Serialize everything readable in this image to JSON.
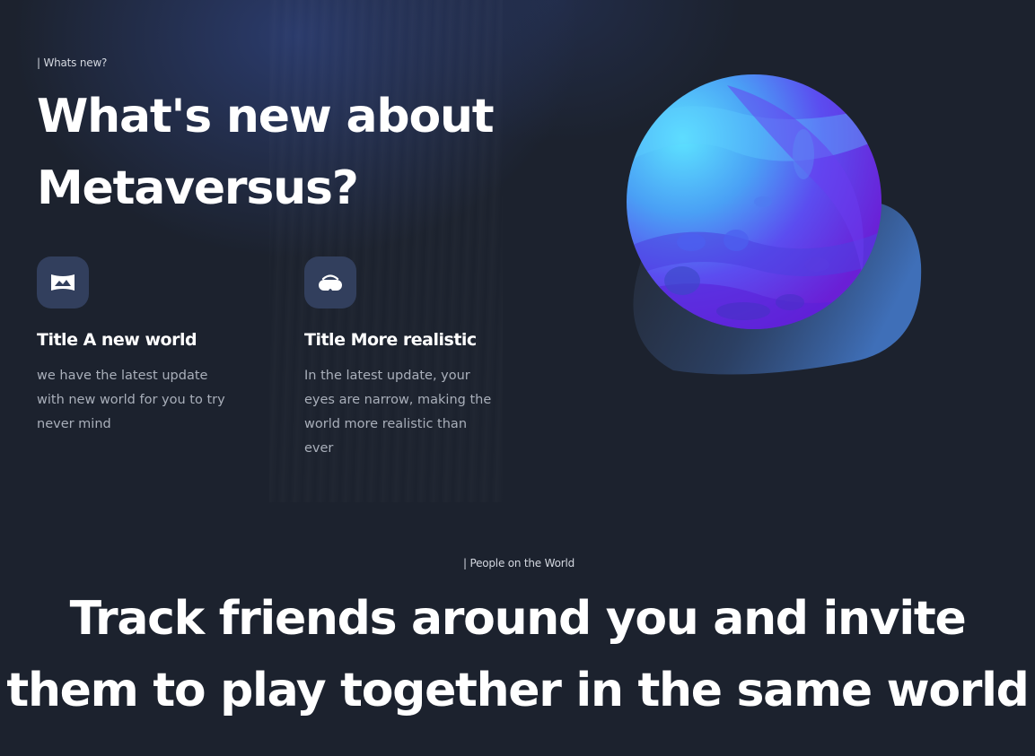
{
  "whats_new": {
    "tag": "| Whats new?",
    "title": "What's new about Metaversus?",
    "features": [
      {
        "icon": "world-map-icon",
        "title": "Title A new world",
        "description": "we have the latest update with new world for you to try never mind"
      },
      {
        "icon": "vr-headset-icon",
        "title": "Title More realistic",
        "description": "In the latest update, your eyes are narrow, making the world more realistic than ever"
      }
    ],
    "illustration": "planet-illustration"
  },
  "people": {
    "tag": "| People on the World",
    "title": "Track friends around you and invite them to play together in the same world"
  },
  "colors": {
    "background": "#1c222e",
    "icon_bg": "#323f5d",
    "text_primary": "#ffffff",
    "text_secondary": "#a9afba"
  }
}
